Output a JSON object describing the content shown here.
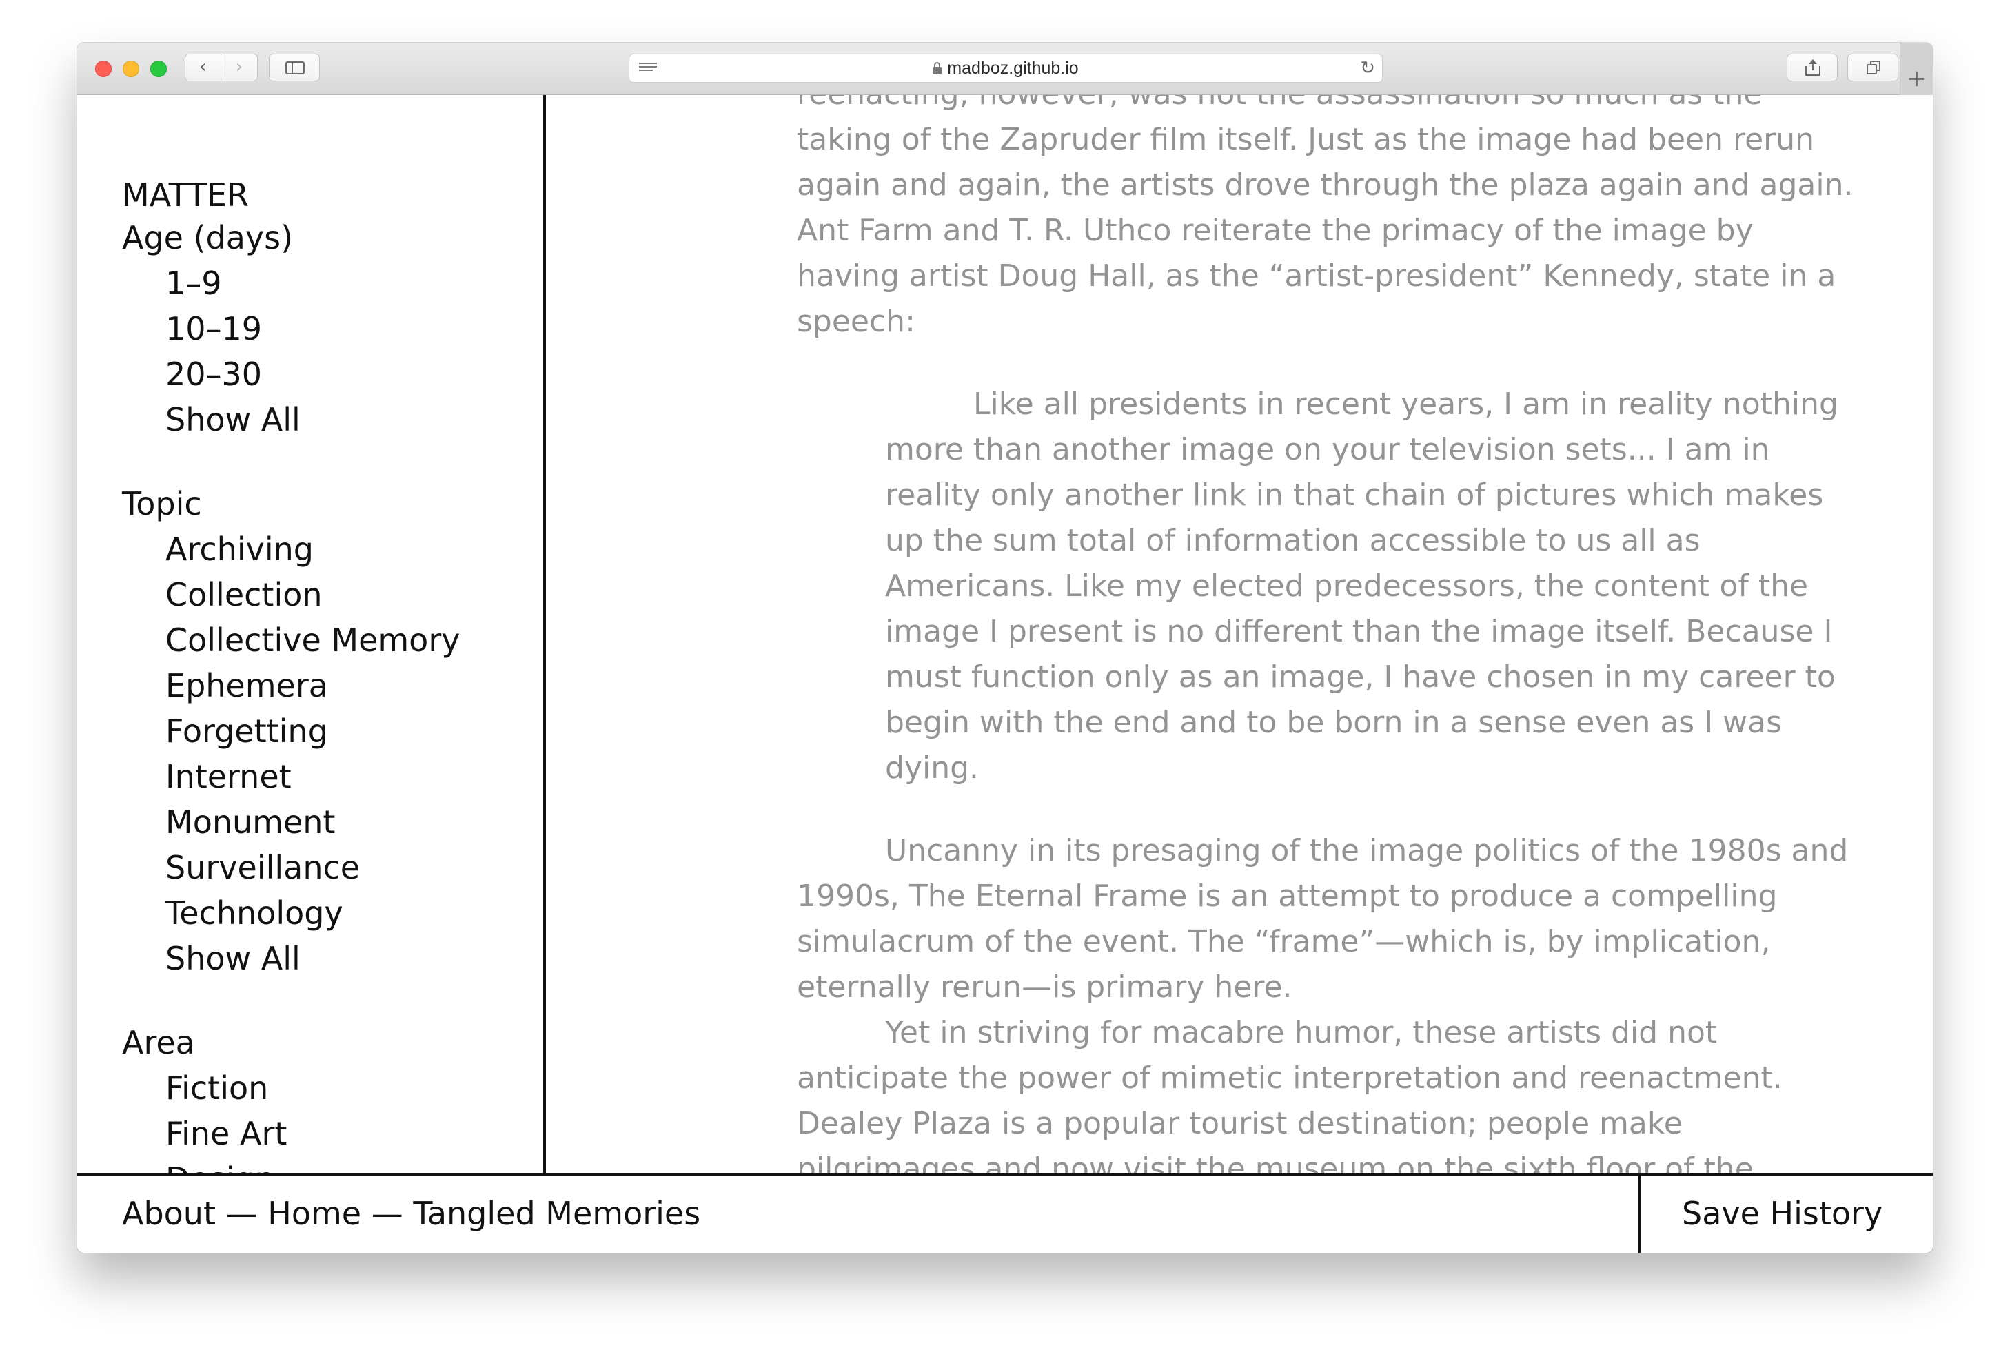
{
  "browser": {
    "url": "madboz.github.io",
    "back_glyph": "‹",
    "forward_glyph": "›",
    "reload_glyph": "↻",
    "new_tab_glyph": "+"
  },
  "sidebar": {
    "title": "MATTER",
    "sections": [
      {
        "heading": "Age (days)",
        "items": [
          "1–9",
          "10–19",
          "20–30",
          "Show All"
        ]
      },
      {
        "heading": "Topic",
        "items": [
          "Archiving",
          "Collection",
          "Collective Memory",
          "Ephemera",
          "Forgetting",
          "Internet",
          "Monument",
          "Surveillance",
          "Technology",
          "Show All"
        ]
      },
      {
        "heading": "Area",
        "items": [
          "Fiction",
          "Fine Art",
          "Design"
        ]
      }
    ]
  },
  "article": {
    "p0": "reenacting, however, was not the assassination so much as the taking of the Zapruder film itself. Just as the image had been rerun again and again, the artists drove through the plaza again and again. Ant Farm and T. R. Uthco reiterate the primacy of the image by having artist Doug Hall, as the “artist-president” Kennedy, state in a speech:",
    "quote": "Like all presidents in recent years, I am in reality nothing more than another image on your television sets... I am in reality only another link in that chain of pictures which makes up the sum total of information accessible to us all as Americans. Like my elected predecessors, the content of the image I present is no different than the image itself. Because I must function only as an image, I have chosen in my career to begin with the end and to be born in a sense even as I was dying.",
    "p1": "Uncanny in its presaging of the image politics of the 1980s and 1990s, The Eternal Frame is an attempt to produce a compelling simulacrum of the event. The “frame”—which is, by implication, eternally rerun—is primary here.",
    "p2": "Yet in striving for macabre humor, these artists did not anticipate the power of mimetic interpretation and reenactment. Dealey Plaza is a popular tourist destination; people make pilgrimages and now visit the museum on the sixth floor of the"
  },
  "footer": {
    "about": "About",
    "sep1": " — ",
    "home": "Home",
    "sep2": " — ",
    "project": "Tangled Memories",
    "save_history": "Save History"
  },
  "colors": {
    "text": "#111111",
    "article_text": "#939393",
    "rule": "#111111"
  }
}
